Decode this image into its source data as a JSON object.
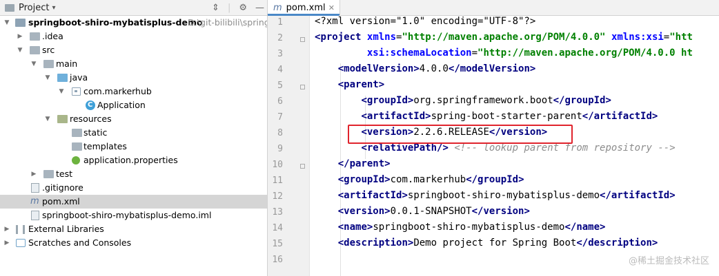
{
  "project": {
    "title": "Project",
    "root_name": "springboot-shiro-mybatisplus-demo",
    "root_path": "D:\\git-bilibili\\springb",
    "items": {
      "idea": ".idea",
      "src": "src",
      "main": "main",
      "java": "java",
      "pkg": "com.markerhub",
      "app": "Application",
      "resources": "resources",
      "static": "static",
      "templates": "templates",
      "props": "application.properties",
      "test": "test",
      "gitignore": ".gitignore",
      "pom": "pom.xml",
      "iml": "springboot-shiro-mybatisplus-demo.iml",
      "ext": "External Libraries",
      "scratch": "Scratches and Consoles"
    }
  },
  "editor": {
    "tab_label": "pom.xml",
    "line_numbers": [
      "1",
      "2",
      "3",
      "4",
      "5",
      "6",
      "7",
      "8",
      "9",
      "10",
      "11",
      "12",
      "13",
      "14",
      "15",
      "16"
    ]
  },
  "code": {
    "l1": "<?xml version=\"1.0\" encoding=\"UTF-8\"?>",
    "l2_tag": "project",
    "l2_a1": "xmlns",
    "l2_v1": "\"http://maven.apache.org/POM/4.0.0\"",
    "l2_a2": "xmlns:xsi",
    "l2_v2": "\"htt",
    "l3_a": "xsi:schemaLocation",
    "l3_v": "\"http://maven.apache.org/POM/4.0.0 ht",
    "modelVersion_tag": "modelVersion",
    "modelVersion_val": "4.0.0",
    "parent_tag": "parent",
    "groupId_tag": "groupId",
    "parent_groupId": "org.springframework.boot",
    "artifactId_tag": "artifactId",
    "parent_artifactId": "spring-boot-starter-parent",
    "version_tag": "version",
    "parent_version": "2.2.6.RELEASE",
    "relativePath_tag": "relativePath",
    "relativePath_comment": "<!-- lookup parent from repository -->",
    "groupId": "com.markerhub",
    "artifactId": "springboot-shiro-mybatisplus-demo",
    "version": "0.0.1-SNAPSHOT",
    "name_tag": "name",
    "name": "springboot-shiro-mybatisplus-demo",
    "description_tag": "description",
    "description": "Demo project for Spring Boot"
  },
  "watermark": "@稀土掘金技术社区",
  "colors": {
    "tag": "#000080",
    "attr": "#0000ff",
    "string": "#008000",
    "highlight": "#e0232c",
    "accent": "#4a88c7"
  }
}
